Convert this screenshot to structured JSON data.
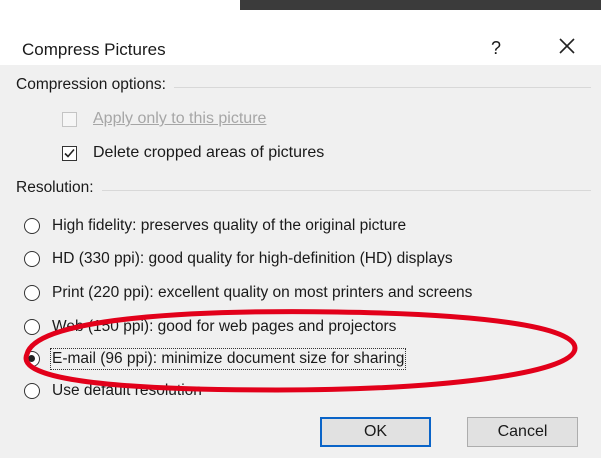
{
  "dialog": {
    "title": "Compress Pictures",
    "help_label": "?",
    "close_icon": "close-icon"
  },
  "compression": {
    "group_label": "Compression options:",
    "apply_only": {
      "label": "Apply only to this picture",
      "checked": false,
      "disabled": true
    },
    "delete_cropped": {
      "label": "Delete cropped areas of pictures",
      "checked": true,
      "disabled": false
    }
  },
  "resolution": {
    "group_label": "Resolution:",
    "options": [
      {
        "label": "High fidelity: preserves quality of the original picture",
        "selected": false
      },
      {
        "label": "HD (330 ppi): good quality for high-definition (HD) displays",
        "selected": false
      },
      {
        "label": "Print (220 ppi): excellent quality on most printers and screens",
        "selected": false
      },
      {
        "label": "Web (150 ppi): good for web pages and projectors",
        "selected": false
      },
      {
        "label": "E-mail (96 ppi): minimize document size for sharing",
        "selected": true
      },
      {
        "label": "Use default resolution",
        "selected": false
      }
    ]
  },
  "buttons": {
    "ok": "OK",
    "cancel": "Cancel"
  },
  "colors": {
    "annotation": "#e2001a",
    "ok_border": "#0a64c8",
    "dialog_bg": "#f0f0f0"
  }
}
